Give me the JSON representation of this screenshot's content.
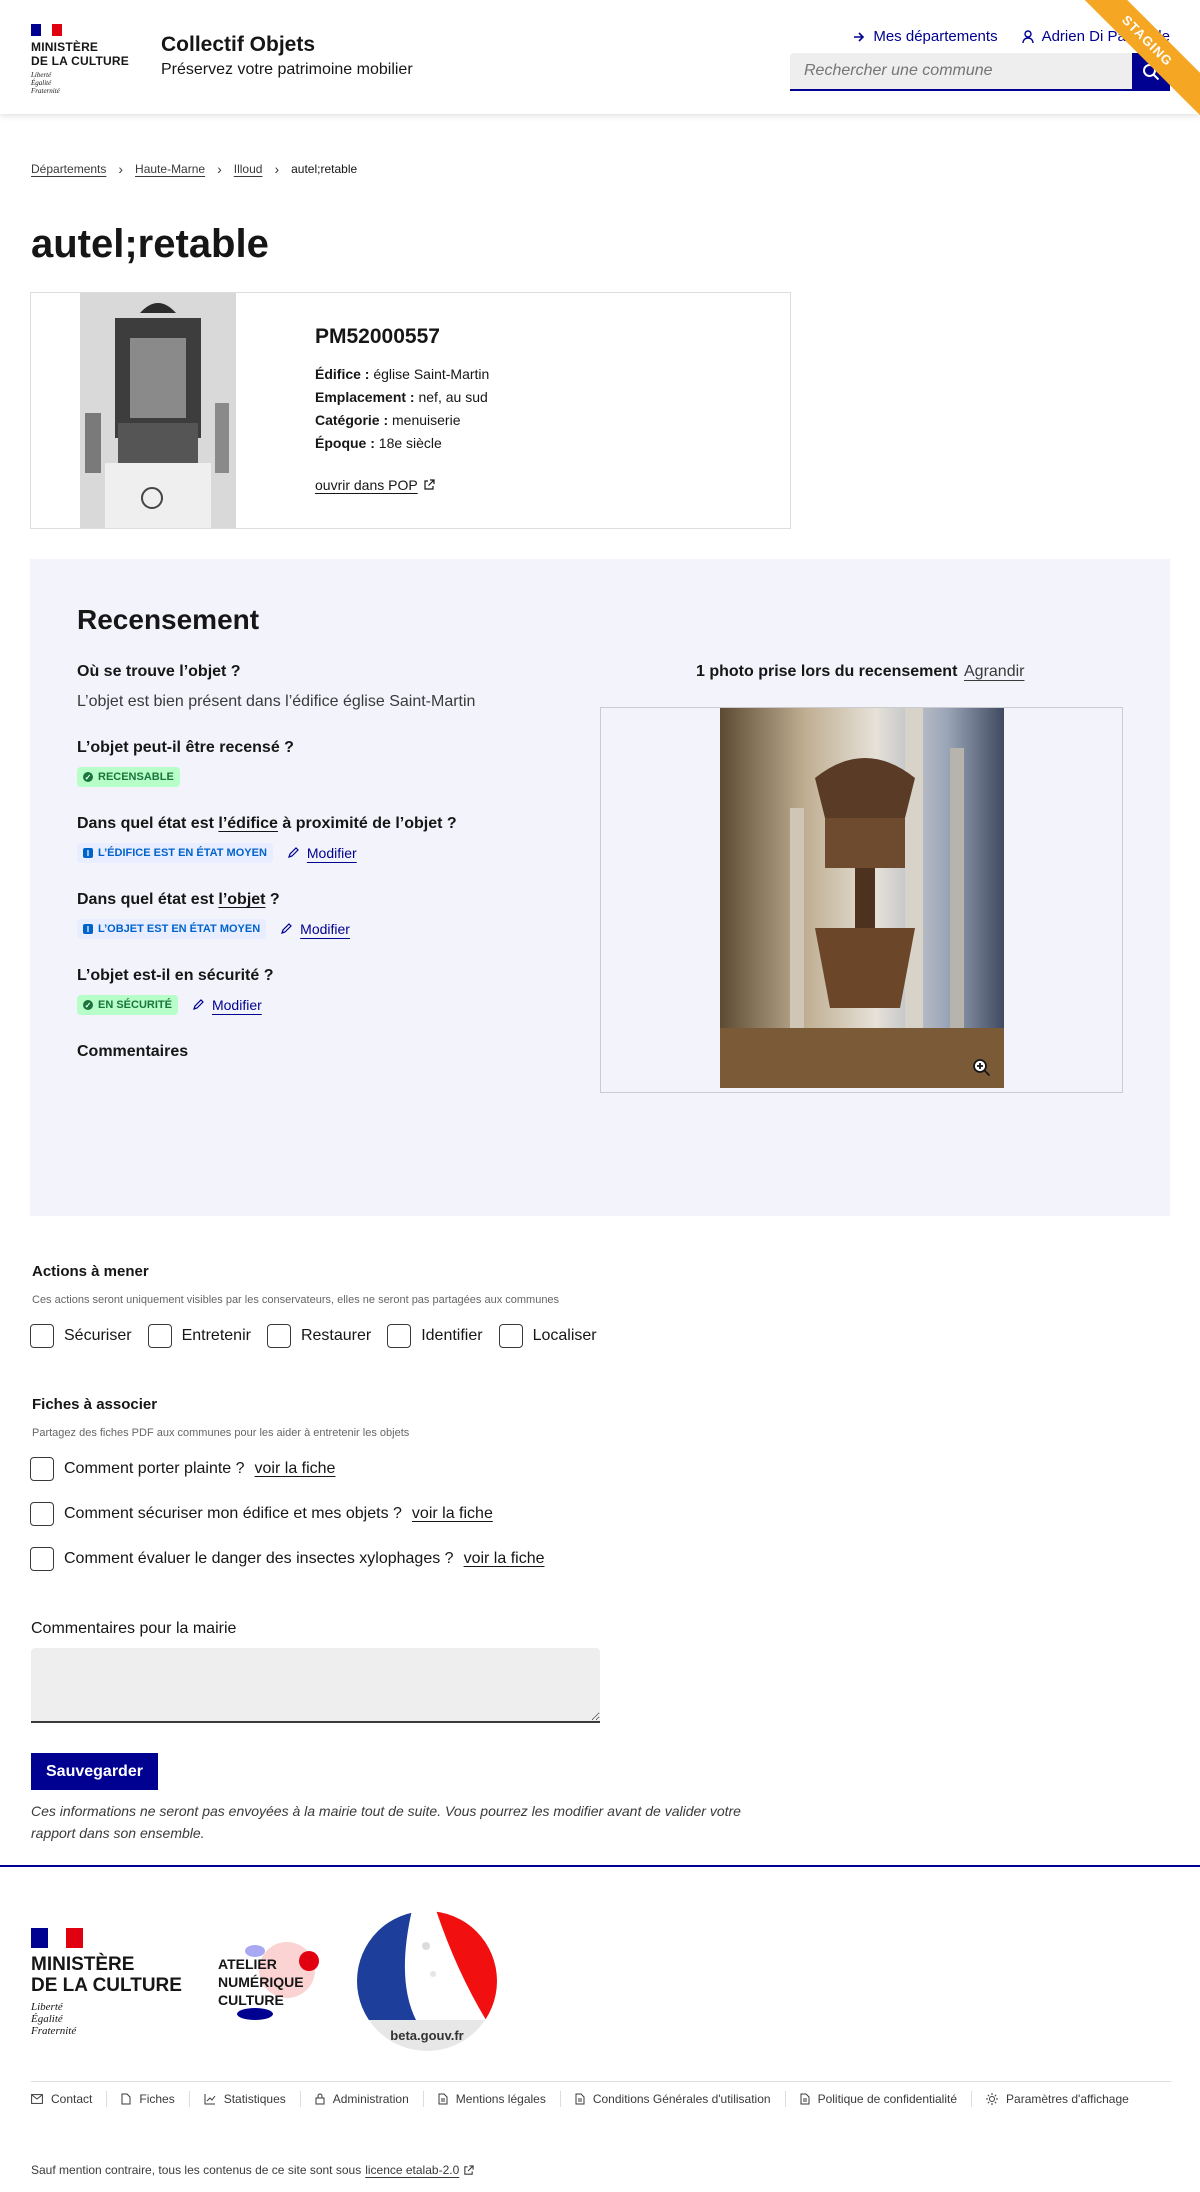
{
  "header": {
    "ministry": "MINISTÈRE\nDE LA CULTURE",
    "motto": [
      "Liberté",
      "Égalité",
      "Fraternité"
    ],
    "site_title": "Collectif Objets",
    "site_tagline": "Préservez votre patrimoine mobilier",
    "link_departements": "Mes départements",
    "link_user": "Adrien Di Pasquale",
    "search_placeholder": "Rechercher une commune",
    "env_ribbon": "STAGING"
  },
  "breadcrumb": {
    "items": [
      "Départements",
      "Haute-Marne",
      "Illoud"
    ],
    "current": "autel;retable"
  },
  "page_title": "autel;retable",
  "notice": {
    "reference": "PM52000557",
    "edifice_label": "Édifice :",
    "edifice_value": "église Saint-Martin",
    "emplacement_label": "Emplacement :",
    "emplacement_value": "nef, au sud",
    "categorie_label": "Catégorie :",
    "categorie_value": "menuiserie",
    "epoque_label": "Époque :",
    "epoque_value": "18e siècle",
    "pop_link": "ouvrir dans POP"
  },
  "recensement": {
    "title": "Recensement",
    "q1": "Où se trouve l’objet ?",
    "a1": "L’objet est bien présent dans l’édifice église Saint-Martin",
    "q2": "L’objet peut-il être recensé ?",
    "badge2": "RECENSABLE",
    "q3_pre": "Dans quel état est ",
    "q3_link": "l’édifice",
    "q3_post": " à proximité de l’objet ?",
    "badge3": "L’ÉDIFICE EST EN ÉTAT MOYEN",
    "q4_pre": "Dans quel état est ",
    "q4_link": "l’objet",
    "q4_post": " ?",
    "badge4": "L’OBJET EST EN ÉTAT MOYEN",
    "q5": "L’objet est-il en sécurité ?",
    "badge5": "EN SÉCURITÉ",
    "modify": "Modifier",
    "comments_title": "Commentaires",
    "photos_title": "1 photo prise lors du recensement",
    "enlarge": "Agrandir"
  },
  "actions": {
    "title": "Actions à mener",
    "hint": "Ces actions seront uniquement visibles par les conservateurs, elles ne seront pas partagées aux communes",
    "items": [
      "Sécuriser",
      "Entretenir",
      "Restaurer",
      "Identifier",
      "Localiser"
    ]
  },
  "fiches": {
    "title": "Fiches à associer",
    "hint": "Partagez des fiches PDF aux communes pour les aider à entretenir les objets",
    "link_label": "voir la fiche",
    "items": [
      "Comment porter plainte ?",
      "Comment sécuriser mon édifice et mes objets ?",
      "Comment évaluer le danger des insectes xylophages ?"
    ]
  },
  "mairie": {
    "label": "Commentaires pour la mairie",
    "save": "Sauvegarder",
    "note": "Ces informations ne seront pas envoyées à la mairie tout de suite. Vous pourrez les modifier avant de valider votre rapport dans son ensemble."
  },
  "footer": {
    "ministry": "MINISTÈRE\nDE LA CULTURE",
    "motto": [
      "Liberté",
      "Égalité",
      "Fraternité"
    ],
    "anc": "ATELIER\nNUMÉRIQUE\nCULTURE",
    "beta": "beta.gouv.fr",
    "links": [
      "Contact",
      "Fiches",
      "Statistiques",
      "Administration",
      "Mentions légales",
      "Conditions Générales d'utilisation",
      "Politique de confidentialité",
      "Paramètres d'affichage"
    ],
    "legal_prefix": "Sauf mention contraire, tous les contenus de ce site sont sous",
    "legal_link": "licence etalab-2.0"
  },
  "colors": {
    "primary": "#000091",
    "flag_blue": "#000091",
    "flag_red": "#e1000f",
    "success_bg": "#b8fec9",
    "success_text": "#18753c",
    "info_bg": "#e8edff",
    "info_text": "#0063cb",
    "ribbon": "#f5a623"
  }
}
